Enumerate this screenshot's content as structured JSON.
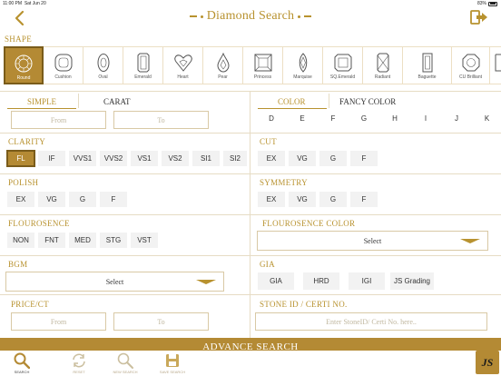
{
  "status_bar": {
    "time": "11:00 PM",
    "date": "Sat Jun 20",
    "battery": "83%"
  },
  "header": {
    "title": "Diamond Search",
    "back_icon": "chevron-left-icon",
    "exit_icon": "logout-icon"
  },
  "shape": {
    "label": "SHAPE",
    "selected": "Round",
    "items": [
      {
        "name": "Round",
        "icon": "round-diamond-icon"
      },
      {
        "name": "Cushion",
        "icon": "cushion-diamond-icon"
      },
      {
        "name": "Oval",
        "icon": "oval-diamond-icon"
      },
      {
        "name": "Emerald",
        "icon": "emerald-diamond-icon"
      },
      {
        "name": "Heart",
        "icon": "heart-diamond-icon"
      },
      {
        "name": "Pear",
        "icon": "pear-diamond-icon"
      },
      {
        "name": "Princess",
        "icon": "princess-diamond-icon"
      },
      {
        "name": "Marquise",
        "icon": "marquise-diamond-icon"
      },
      {
        "name": "SQ.Emerald",
        "icon": "sq-emerald-diamond-icon"
      },
      {
        "name": "Radiant",
        "icon": "radiant-diamond-icon"
      },
      {
        "name": "Baguette",
        "icon": "baguette-diamond-icon"
      },
      {
        "name": "CU Brilliant",
        "icon": "cu-brilliant-diamond-icon"
      }
    ]
  },
  "size_tabs": {
    "simple": "SIMPLE",
    "carat": "CARAT"
  },
  "size_inputs": {
    "from_placeholder": "From",
    "to_placeholder": "To"
  },
  "color_tabs": {
    "color": "COLOR",
    "fancy": "FANCY COLOR"
  },
  "color_options": [
    "D",
    "E",
    "F",
    "G",
    "H",
    "I",
    "J",
    "K"
  ],
  "clarity": {
    "label": "CLARITY",
    "options": [
      "FL",
      "IF",
      "VVS1",
      "VVS2",
      "VS1",
      "VS2",
      "SI1",
      "SI2"
    ],
    "selected": "FL"
  },
  "cut": {
    "label": "CUT",
    "options": [
      "EX",
      "VG",
      "G",
      "F"
    ]
  },
  "polish": {
    "label": "POLISH",
    "options": [
      "EX",
      "VG",
      "G",
      "F"
    ]
  },
  "symmetry": {
    "label": "SYMMETRY",
    "options": [
      "EX",
      "VG",
      "G",
      "F"
    ]
  },
  "flourosence": {
    "label": "FLOURОSENCE",
    "options": [
      "NON",
      "FNT",
      "MED",
      "STG",
      "VST"
    ]
  },
  "flourosence_color": {
    "label": "FLOUROSENCE COLOR",
    "value": "Select"
  },
  "bgm": {
    "label": "BGM",
    "value": "Select"
  },
  "gia": {
    "label": "GIA",
    "options": [
      "GIA",
      "HRD",
      "IGI",
      "JS Grading"
    ]
  },
  "price_ct": {
    "label": "PRICE/CT",
    "from_placeholder": "From",
    "to_placeholder": "To"
  },
  "stone_id": {
    "label": "STONE ID / CERTI NO.",
    "placeholder": "Enter StoneID/ Certi No. here.."
  },
  "advance_search": {
    "label": "ADVANCE SEARCH"
  },
  "bottom_nav": [
    {
      "label": "SEARCH",
      "icon": "search-icon",
      "active": true
    },
    {
      "label": "RESET",
      "icon": "reset-icon",
      "active": false
    },
    {
      "label": "NEW SEARCH",
      "icon": "new-search-icon",
      "active": false
    },
    {
      "label": "SAVE SEARCH",
      "icon": "save-icon",
      "active": false
    }
  ],
  "brand": {
    "logo_text": "JS"
  },
  "colors": {
    "gold": "#b8922f",
    "gold_fill": "#b48a34",
    "border": "#e6dcc4",
    "chip_bg": "#f2f2f2"
  }
}
